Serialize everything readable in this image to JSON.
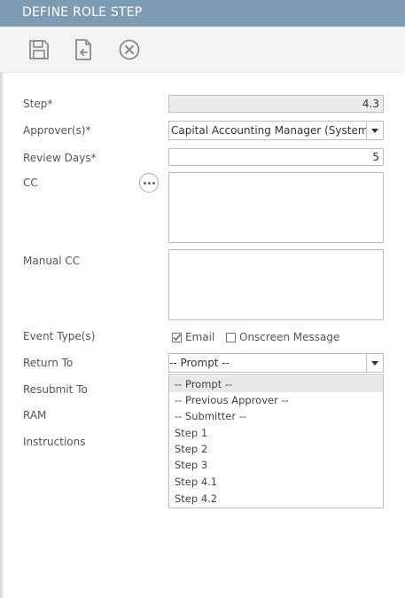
{
  "header": {
    "title": "DEFINE ROLE STEP"
  },
  "toolbar": {
    "save_icon": "save-icon",
    "export_icon": "export-icon",
    "cancel_icon": "close-circle-icon"
  },
  "form": {
    "step": {
      "label": "Step*",
      "value": "4.3"
    },
    "approvers": {
      "label": "Approver(s)*",
      "value": "Capital Accounting Manager (System)"
    },
    "review_days": {
      "label": "Review Days*",
      "value": "5"
    },
    "cc": {
      "label": "CC",
      "value": ""
    },
    "manual_cc": {
      "label": "Manual CC",
      "value": ""
    },
    "event_types": {
      "label": "Event Type(s)",
      "email": {
        "label": "Email",
        "checked": true
      },
      "onscreen": {
        "label": "Onscreen Message",
        "checked": false
      }
    },
    "return_to": {
      "label": "Return To",
      "value": "-- Prompt --",
      "options": [
        "-- Prompt --",
        "-- Previous Approver --",
        "-- Submitter --",
        "Step 1",
        "Step 2",
        "Step 3",
        "Step 4.1",
        "Step 4.2"
      ],
      "highlighted": "-- Prompt --"
    },
    "resubmit_to": {
      "label": "Resubmit To"
    },
    "ram": {
      "label": "RAM"
    },
    "instructions": {
      "label": "Instructions"
    }
  }
}
